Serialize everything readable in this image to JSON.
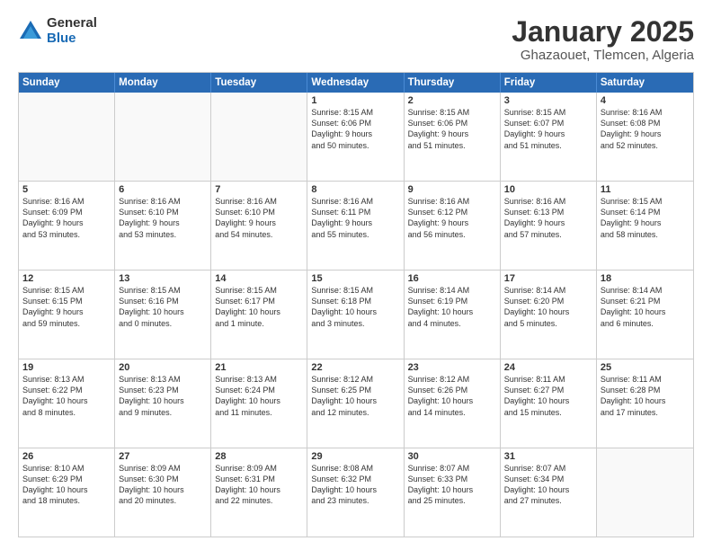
{
  "logo": {
    "general": "General",
    "blue": "Blue"
  },
  "title": "January 2025",
  "subtitle": "Ghazaouet, Tlemcen, Algeria",
  "dayHeaders": [
    "Sunday",
    "Monday",
    "Tuesday",
    "Wednesday",
    "Thursday",
    "Friday",
    "Saturday"
  ],
  "weeks": [
    [
      {
        "day": "",
        "text": "",
        "empty": true
      },
      {
        "day": "",
        "text": "",
        "empty": true
      },
      {
        "day": "",
        "text": "",
        "empty": true
      },
      {
        "day": "1",
        "text": "Sunrise: 8:15 AM\nSunset: 6:06 PM\nDaylight: 9 hours\nand 50 minutes.",
        "empty": false
      },
      {
        "day": "2",
        "text": "Sunrise: 8:15 AM\nSunset: 6:06 PM\nDaylight: 9 hours\nand 51 minutes.",
        "empty": false
      },
      {
        "day": "3",
        "text": "Sunrise: 8:15 AM\nSunset: 6:07 PM\nDaylight: 9 hours\nand 51 minutes.",
        "empty": false
      },
      {
        "day": "4",
        "text": "Sunrise: 8:16 AM\nSunset: 6:08 PM\nDaylight: 9 hours\nand 52 minutes.",
        "empty": false
      }
    ],
    [
      {
        "day": "5",
        "text": "Sunrise: 8:16 AM\nSunset: 6:09 PM\nDaylight: 9 hours\nand 53 minutes.",
        "empty": false
      },
      {
        "day": "6",
        "text": "Sunrise: 8:16 AM\nSunset: 6:10 PM\nDaylight: 9 hours\nand 53 minutes.",
        "empty": false
      },
      {
        "day": "7",
        "text": "Sunrise: 8:16 AM\nSunset: 6:10 PM\nDaylight: 9 hours\nand 54 minutes.",
        "empty": false
      },
      {
        "day": "8",
        "text": "Sunrise: 8:16 AM\nSunset: 6:11 PM\nDaylight: 9 hours\nand 55 minutes.",
        "empty": false
      },
      {
        "day": "9",
        "text": "Sunrise: 8:16 AM\nSunset: 6:12 PM\nDaylight: 9 hours\nand 56 minutes.",
        "empty": false
      },
      {
        "day": "10",
        "text": "Sunrise: 8:16 AM\nSunset: 6:13 PM\nDaylight: 9 hours\nand 57 minutes.",
        "empty": false
      },
      {
        "day": "11",
        "text": "Sunrise: 8:15 AM\nSunset: 6:14 PM\nDaylight: 9 hours\nand 58 minutes.",
        "empty": false
      }
    ],
    [
      {
        "day": "12",
        "text": "Sunrise: 8:15 AM\nSunset: 6:15 PM\nDaylight: 9 hours\nand 59 minutes.",
        "empty": false
      },
      {
        "day": "13",
        "text": "Sunrise: 8:15 AM\nSunset: 6:16 PM\nDaylight: 10 hours\nand 0 minutes.",
        "empty": false
      },
      {
        "day": "14",
        "text": "Sunrise: 8:15 AM\nSunset: 6:17 PM\nDaylight: 10 hours\nand 1 minute.",
        "empty": false
      },
      {
        "day": "15",
        "text": "Sunrise: 8:15 AM\nSunset: 6:18 PM\nDaylight: 10 hours\nand 3 minutes.",
        "empty": false
      },
      {
        "day": "16",
        "text": "Sunrise: 8:14 AM\nSunset: 6:19 PM\nDaylight: 10 hours\nand 4 minutes.",
        "empty": false
      },
      {
        "day": "17",
        "text": "Sunrise: 8:14 AM\nSunset: 6:20 PM\nDaylight: 10 hours\nand 5 minutes.",
        "empty": false
      },
      {
        "day": "18",
        "text": "Sunrise: 8:14 AM\nSunset: 6:21 PM\nDaylight: 10 hours\nand 6 minutes.",
        "empty": false
      }
    ],
    [
      {
        "day": "19",
        "text": "Sunrise: 8:13 AM\nSunset: 6:22 PM\nDaylight: 10 hours\nand 8 minutes.",
        "empty": false
      },
      {
        "day": "20",
        "text": "Sunrise: 8:13 AM\nSunset: 6:23 PM\nDaylight: 10 hours\nand 9 minutes.",
        "empty": false
      },
      {
        "day": "21",
        "text": "Sunrise: 8:13 AM\nSunset: 6:24 PM\nDaylight: 10 hours\nand 11 minutes.",
        "empty": false
      },
      {
        "day": "22",
        "text": "Sunrise: 8:12 AM\nSunset: 6:25 PM\nDaylight: 10 hours\nand 12 minutes.",
        "empty": false
      },
      {
        "day": "23",
        "text": "Sunrise: 8:12 AM\nSunset: 6:26 PM\nDaylight: 10 hours\nand 14 minutes.",
        "empty": false
      },
      {
        "day": "24",
        "text": "Sunrise: 8:11 AM\nSunset: 6:27 PM\nDaylight: 10 hours\nand 15 minutes.",
        "empty": false
      },
      {
        "day": "25",
        "text": "Sunrise: 8:11 AM\nSunset: 6:28 PM\nDaylight: 10 hours\nand 17 minutes.",
        "empty": false
      }
    ],
    [
      {
        "day": "26",
        "text": "Sunrise: 8:10 AM\nSunset: 6:29 PM\nDaylight: 10 hours\nand 18 minutes.",
        "empty": false
      },
      {
        "day": "27",
        "text": "Sunrise: 8:09 AM\nSunset: 6:30 PM\nDaylight: 10 hours\nand 20 minutes.",
        "empty": false
      },
      {
        "day": "28",
        "text": "Sunrise: 8:09 AM\nSunset: 6:31 PM\nDaylight: 10 hours\nand 22 minutes.",
        "empty": false
      },
      {
        "day": "29",
        "text": "Sunrise: 8:08 AM\nSunset: 6:32 PM\nDaylight: 10 hours\nand 23 minutes.",
        "empty": false
      },
      {
        "day": "30",
        "text": "Sunrise: 8:07 AM\nSunset: 6:33 PM\nDaylight: 10 hours\nand 25 minutes.",
        "empty": false
      },
      {
        "day": "31",
        "text": "Sunrise: 8:07 AM\nSunset: 6:34 PM\nDaylight: 10 hours\nand 27 minutes.",
        "empty": false
      },
      {
        "day": "",
        "text": "",
        "empty": true
      }
    ]
  ]
}
